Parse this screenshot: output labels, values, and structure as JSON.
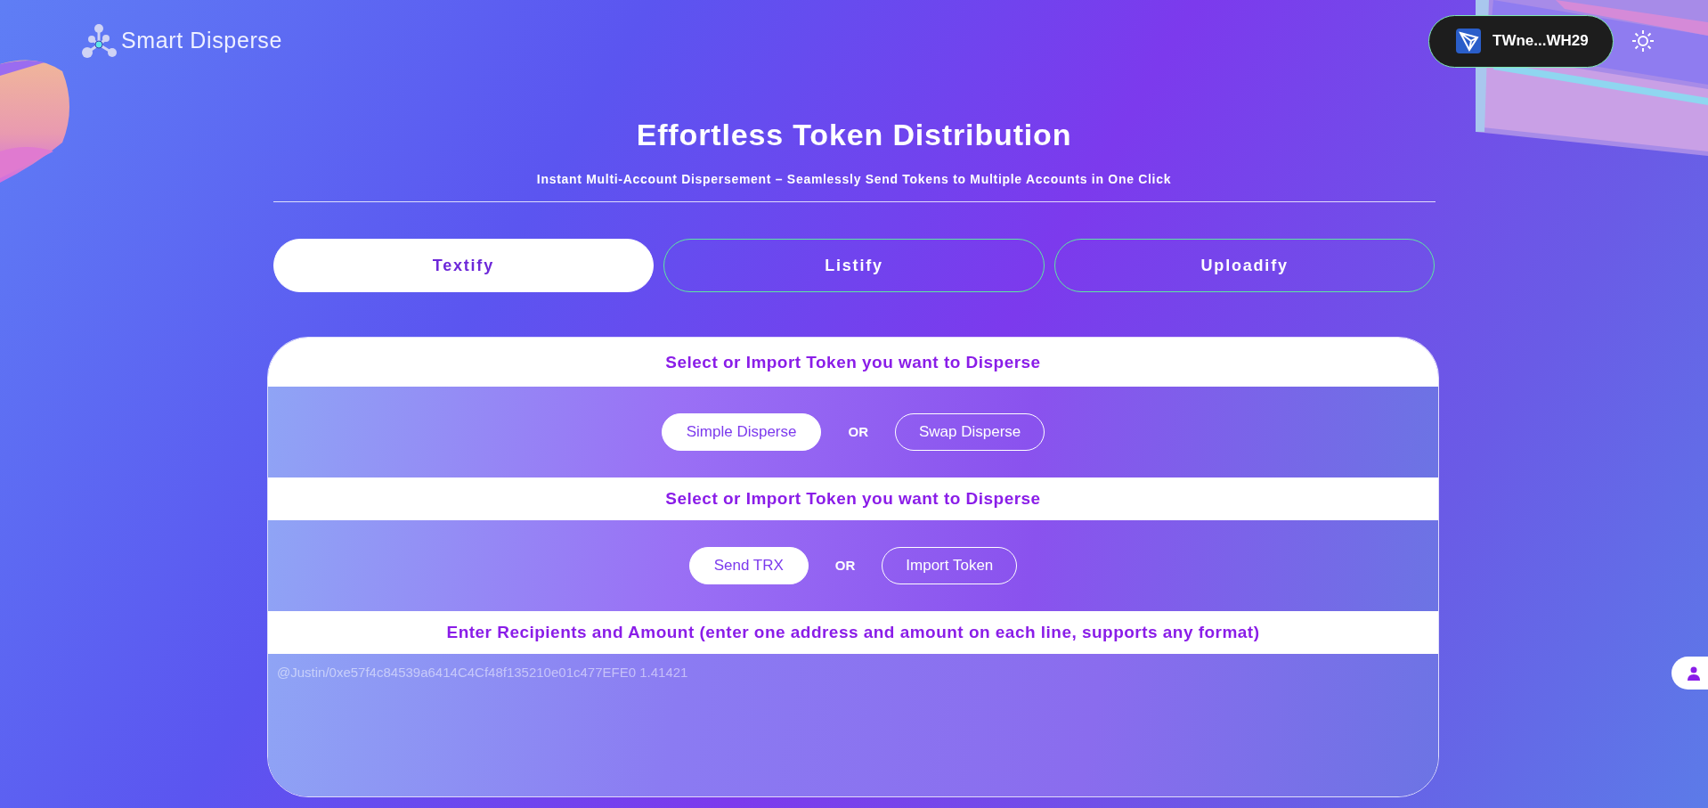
{
  "header": {
    "brand": "Smart Disperse",
    "wallet": "TWne...WH29"
  },
  "hero": {
    "title": "Effortless Token Distribution",
    "subtitle": "Instant Multi-Account Dispersement – Seamlessly Send Tokens to Multiple Accounts in One Click"
  },
  "tabs": [
    {
      "label": "Textify",
      "selected": true
    },
    {
      "label": "Listify",
      "selected": false
    },
    {
      "label": "Uploadify",
      "selected": false
    }
  ],
  "sections": [
    {
      "heading": "Select or Import Token you want to Disperse",
      "separator": "OR",
      "options": [
        {
          "label": "Simple Disperse",
          "selected": true
        },
        {
          "label": "Swap Disperse",
          "selected": false
        }
      ]
    },
    {
      "heading": "Select or Import Token you want to Disperse",
      "separator": "OR",
      "options": [
        {
          "label": "Send TRX",
          "selected": true
        },
        {
          "label": "Import Token",
          "selected": false
        }
      ]
    }
  ],
  "recipients": {
    "heading": "Enter Recipients and Amount (enter one address and amount on each line, supports any format)",
    "placeholder": "@Justin/0xe57f4c84539a6414C4Cf48f135210e01c477EFE0 1.41421"
  }
}
